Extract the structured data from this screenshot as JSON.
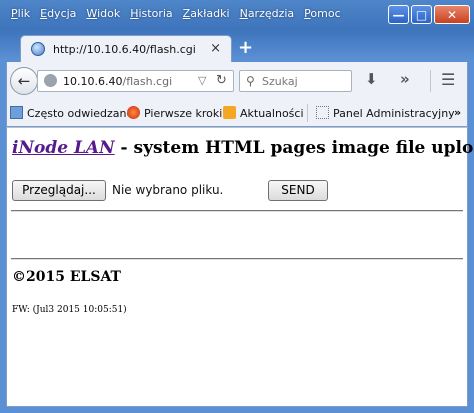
{
  "menu": [
    {
      "label": "Plik",
      "ul": "P",
      "rest": "lik"
    },
    {
      "label": "Edycja",
      "ul": "E",
      "rest": "dycja"
    },
    {
      "label": "Widok",
      "ul": "W",
      "rest": "idok"
    },
    {
      "label": "Historia",
      "ul": "H",
      "rest": "istoria"
    },
    {
      "label": "Zakładki",
      "ul": "Z",
      "rest": "akładki"
    },
    {
      "label": "Narzędzia",
      "ul": "N",
      "rest": "arzędzia"
    },
    {
      "label": "Pomoc",
      "ul": "P",
      "rest": "omoc"
    }
  ],
  "tab": {
    "title": "http://10.10.6.40/flash.cgi",
    "close": "×"
  },
  "newtab": "+",
  "url": {
    "host": "10.10.6.40",
    "path": "/flash.cgi"
  },
  "search": {
    "placeholder": "Szukaj"
  },
  "bookmarks": [
    {
      "label": "Często odwiedzane",
      "icon": "frequent-icon"
    },
    {
      "label": "Pierwsze kroki",
      "icon": "firefox-icon"
    },
    {
      "label": "Aktualności",
      "icon": "rss-icon"
    },
    {
      "label": "Panel Administracyjny",
      "icon": "page-icon"
    }
  ],
  "page": {
    "brand": "iNode LAN",
    "heading_rest": " - system HTML pages image file upload",
    "browse_button": "Przeglądaj...",
    "no_file": "Nie wybrano pliku.",
    "send_button": "SEND",
    "copyright": "©2015 ELSAT",
    "firmware": "FW: (Jul3 2015 10:05:51)"
  }
}
